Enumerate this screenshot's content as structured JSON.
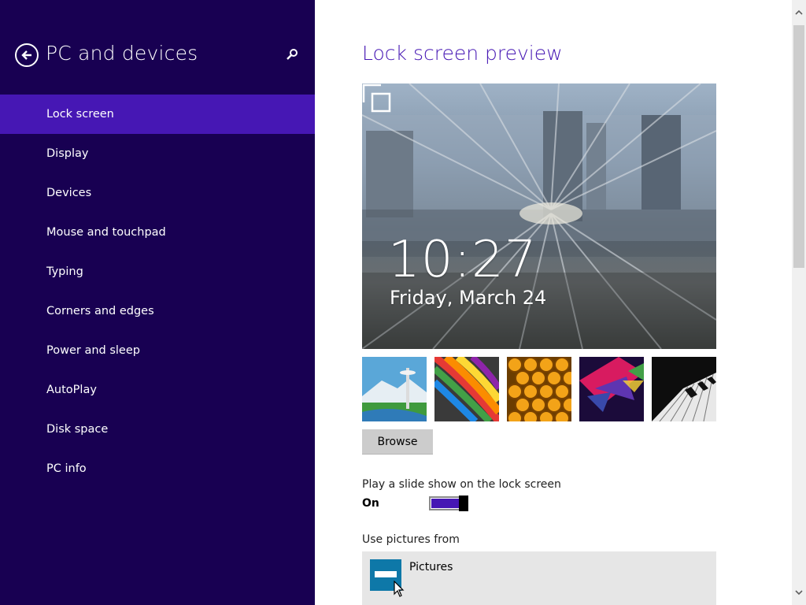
{
  "sidebar": {
    "title": "PC and devices",
    "back_icon": "back-arrow-circle-icon",
    "search_icon": "search-icon",
    "items": [
      {
        "label": "Lock screen",
        "selected": true
      },
      {
        "label": "Display",
        "selected": false
      },
      {
        "label": "Devices",
        "selected": false
      },
      {
        "label": "Mouse and touchpad",
        "selected": false
      },
      {
        "label": "Typing",
        "selected": false
      },
      {
        "label": "Corners and edges",
        "selected": false
      },
      {
        "label": "Power and sleep",
        "selected": false
      },
      {
        "label": "AutoPlay",
        "selected": false
      },
      {
        "label": "Disk space",
        "selected": false
      },
      {
        "label": "PC info",
        "selected": false
      }
    ]
  },
  "main": {
    "title": "Lock screen preview",
    "preview": {
      "time": "10:27",
      "date": "Friday, March 24",
      "overlay_icon": "window-switch-icon"
    },
    "thumbnails": [
      "space-needle-thumbnail",
      "color-ribbons-thumbnail",
      "honeycomb-thumbnail",
      "geometric-shapes-thumbnail",
      "piano-keys-thumbnail"
    ],
    "browse_label": "Browse",
    "slideshow": {
      "label": "Play a slide show on the lock screen",
      "state": "On",
      "enabled": true
    },
    "pictures_source": {
      "label": "Use pictures from",
      "item": "Pictures",
      "icon": "pictures-library-icon"
    }
  },
  "colors": {
    "sidebar_bg": "#180052",
    "accent": "#4617b4",
    "main_bg": "#ffffff",
    "source_item_bg": "#e6e6e6",
    "source_icon_bg": "#0e78a8"
  }
}
